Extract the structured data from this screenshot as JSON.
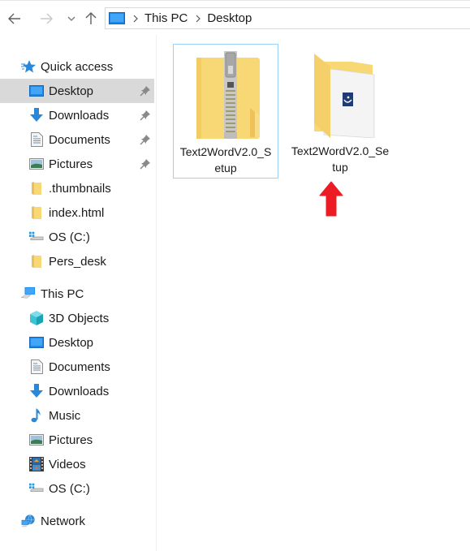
{
  "nav": {
    "back_icon": "arrow-left-icon",
    "forward_icon": "arrow-right-icon",
    "recent_icon": "chevron-down-icon",
    "up_icon": "arrow-up-icon"
  },
  "address_bar": {
    "location_icon": "this-pc-icon",
    "breadcrumbs": [
      "This PC",
      "Desktop"
    ]
  },
  "sidebar": {
    "quick_access": {
      "label": "Quick access",
      "icon": "star-icon",
      "items": [
        {
          "label": "Desktop",
          "icon": "desktop-icon",
          "pinned": true,
          "selected": true
        },
        {
          "label": "Downloads",
          "icon": "download-icon",
          "pinned": true
        },
        {
          "label": "Documents",
          "icon": "documents-icon",
          "pinned": true
        },
        {
          "label": "Pictures",
          "icon": "pictures-icon",
          "pinned": true
        },
        {
          "label": ".thumbnails",
          "icon": "folder-icon"
        },
        {
          "label": "index.html",
          "icon": "folder-icon"
        },
        {
          "label": "OS (C:)",
          "icon": "drive-icon"
        },
        {
          "label": "Pers_desk",
          "icon": "folder-icon"
        }
      ]
    },
    "this_pc": {
      "label": "This PC",
      "icon": "computer-icon",
      "items": [
        {
          "label": "3D Objects",
          "icon": "cube-icon"
        },
        {
          "label": "Desktop",
          "icon": "desktop-icon"
        },
        {
          "label": "Documents",
          "icon": "documents-icon"
        },
        {
          "label": "Downloads",
          "icon": "download-icon"
        },
        {
          "label": "Music",
          "icon": "music-icon"
        },
        {
          "label": "Pictures",
          "icon": "pictures-icon"
        },
        {
          "label": "Videos",
          "icon": "videos-icon"
        },
        {
          "label": "OS (C:)",
          "icon": "drive-icon"
        }
      ]
    },
    "network": {
      "label": "Network",
      "icon": "network-icon"
    }
  },
  "files": [
    {
      "name": "Text2WordV2.0_Setup",
      "type": "zip-folder",
      "selected": true
    },
    {
      "name": "Text2WordV2.0_Setup",
      "type": "extracted-folder",
      "selected": false
    }
  ],
  "annotation": {
    "type": "red-arrow-up",
    "color": "#ed1c24"
  },
  "colors": {
    "selection_bg": "#d9d9d9",
    "tile_border": "#99d1ff",
    "folder_yellow": "#f8d775",
    "accent_blue": "#1e88e5"
  }
}
